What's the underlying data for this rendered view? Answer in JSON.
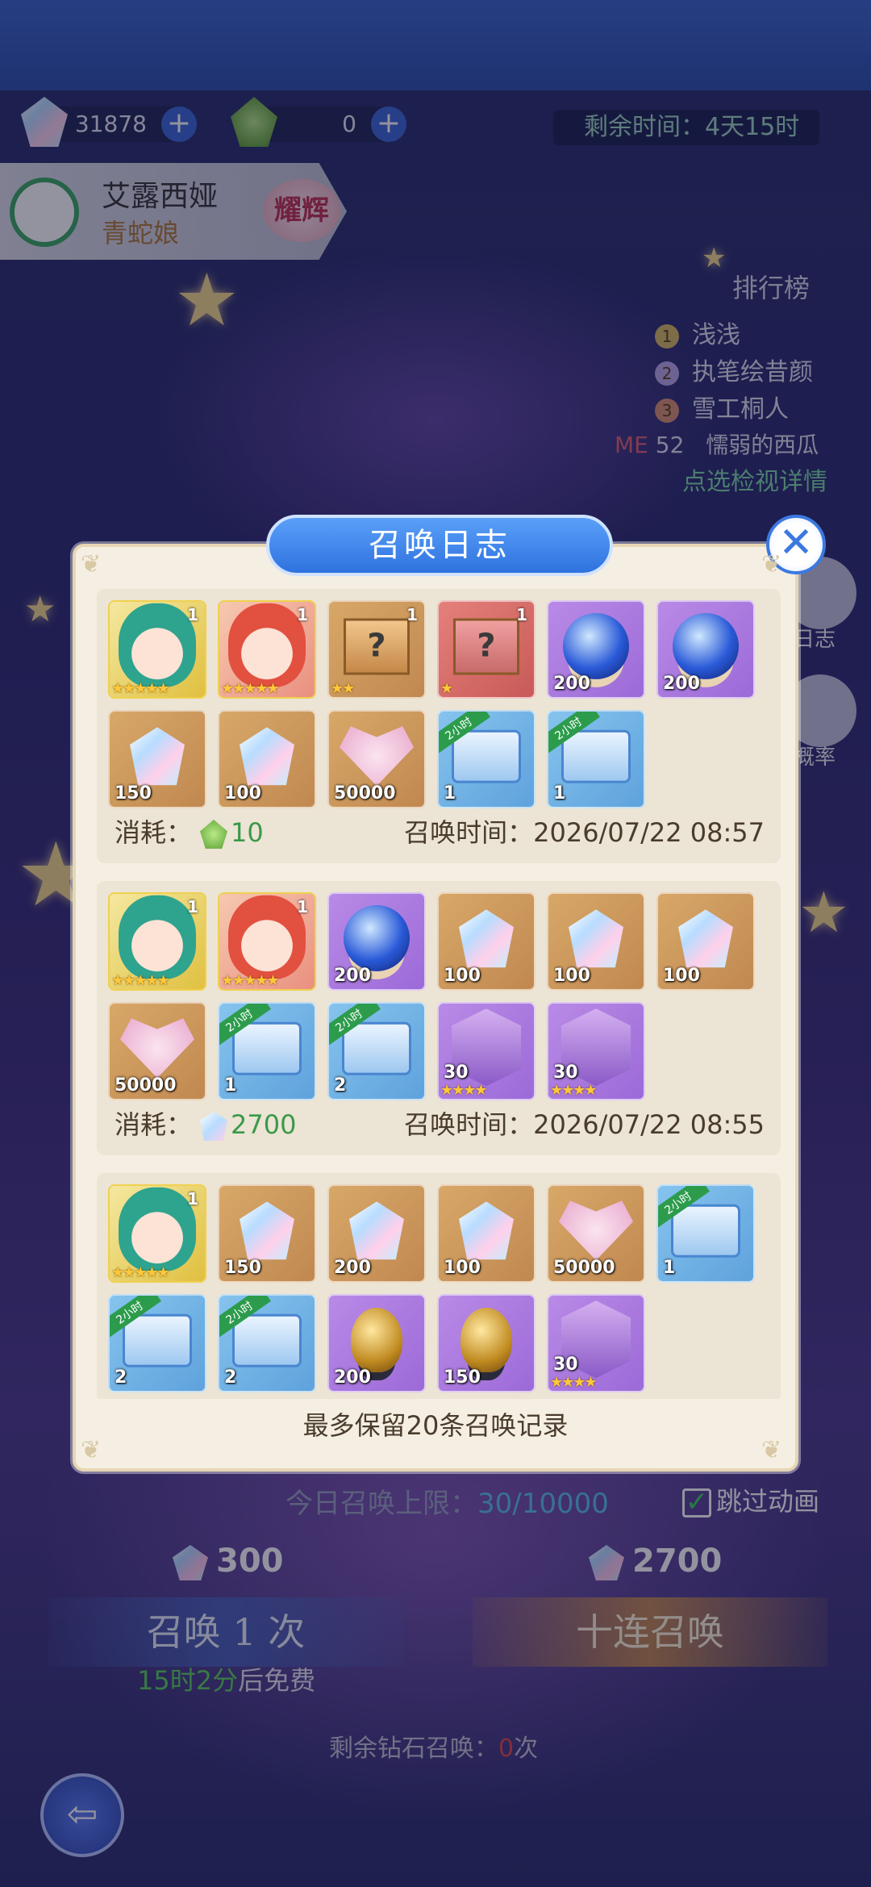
{
  "currency": {
    "diamonds": "31878",
    "hops": "0"
  },
  "timer": {
    "text": "剩余时间：4天15时"
  },
  "character": {
    "name": "艾露西娅",
    "title": "青蛇娘",
    "badge": "耀辉"
  },
  "ranking": {
    "title": "排行榜",
    "entries": [
      {
        "rank": "1",
        "name": "浅浅"
      },
      {
        "rank": "2",
        "name": "执笔绘昔颜"
      },
      {
        "rank": "3",
        "name": "雪工桐人"
      }
    ],
    "me": {
      "label": "ME",
      "rank": "52",
      "name": "懦弱的西瓜"
    },
    "link": "点选检视详情"
  },
  "side_buttons": {
    "log": "日志",
    "rate": "概率"
  },
  "modal": {
    "title": "召唤日志",
    "footer": "最多保留20条召唤记录",
    "cost_label": "消耗：",
    "time_label": "召唤时间：",
    "records": [
      {
        "cost": "10",
        "time": "2026/07/22 08:57",
        "items": [
          {
            "art": "face-green",
            "bg": "char-green",
            "level": "1",
            "stars": "★★★★★"
          },
          {
            "art": "face-red",
            "bg": "char-red",
            "level": "1",
            "stars": "★★★★★"
          },
          {
            "art": "box",
            "bg": "gold",
            "level": "1",
            "stars": "★★"
          },
          {
            "art": "box-red",
            "bg": "red",
            "level": "1",
            "stars": "★"
          },
          {
            "art": "orb",
            "bg": "purple",
            "qty": "200"
          },
          {
            "art": "orb",
            "bg": "purple",
            "qty": "200"
          },
          {
            "art": "crystal",
            "bg": "gold",
            "qty": "150"
          },
          {
            "art": "crystal",
            "bg": "gold",
            "qty": "100"
          },
          {
            "art": "heart",
            "bg": "gold",
            "qty": "50000"
          },
          {
            "art": "chest",
            "bg": "blue",
            "qty": "1",
            "tag": "2小时"
          },
          {
            "art": "chest",
            "bg": "blue",
            "qty": "1",
            "tag": "2小时"
          }
        ]
      },
      {
        "cost": "2700",
        "time": "2026/07/22 08:55",
        "items": [
          {
            "art": "face-green",
            "bg": "char-green",
            "level": "1",
            "stars": "★★★★★"
          },
          {
            "art": "face-red",
            "bg": "char-red",
            "level": "1",
            "stars": "★★★★★"
          },
          {
            "art": "orb",
            "bg": "purple",
            "qty": "200"
          },
          {
            "art": "crystal",
            "bg": "gold",
            "qty": "100"
          },
          {
            "art": "crystal",
            "bg": "gold",
            "qty": "100"
          },
          {
            "art": "crystal",
            "bg": "gold",
            "qty": "100"
          },
          {
            "art": "heart",
            "bg": "gold",
            "qty": "50000"
          },
          {
            "art": "chest",
            "bg": "blue",
            "qty": "1",
            "tag": "2小时"
          },
          {
            "art": "chest",
            "bg": "blue",
            "qty": "2",
            "tag": "2小时"
          },
          {
            "art": "shard",
            "bg": "purple",
            "qty": "30",
            "stars": "★★★★"
          },
          {
            "art": "shard",
            "bg": "purple",
            "qty": "30",
            "stars": "★★★★"
          }
        ]
      },
      {
        "cost": "",
        "time": "",
        "items": [
          {
            "art": "face-green",
            "bg": "char-green",
            "level": "1",
            "stars": "★★★★★"
          },
          {
            "art": "crystal",
            "bg": "gold",
            "qty": "150"
          },
          {
            "art": "crystal",
            "bg": "gold",
            "qty": "200"
          },
          {
            "art": "crystal",
            "bg": "gold",
            "qty": "100"
          },
          {
            "art": "heart",
            "bg": "gold",
            "qty": "50000"
          },
          {
            "art": "chest",
            "bg": "blue",
            "qty": "1",
            "tag": "2小时"
          },
          {
            "art": "chest",
            "bg": "blue",
            "qty": "2",
            "tag": "2小时"
          },
          {
            "art": "chest",
            "bg": "blue",
            "qty": "2",
            "tag": "2小时"
          },
          {
            "art": "egg",
            "bg": "purple",
            "qty": "200"
          },
          {
            "art": "egg",
            "bg": "purple",
            "qty": "150"
          },
          {
            "art": "shard",
            "bg": "purple",
            "qty": "30",
            "stars": "★★★★"
          }
        ]
      }
    ]
  },
  "summon": {
    "limit_label": "今日召唤上限：",
    "limit_value": "30/10000",
    "skip_label": "跳过动画",
    "single_cost": "300",
    "ten_cost": "2700",
    "single_label": "召唤 1 次",
    "ten_label": "十连召唤",
    "free_time": "15时2分",
    "free_suffix": "后免费",
    "remain_label": "剩余钻石召唤：",
    "remain_value": "0",
    "remain_suffix": "次"
  },
  "icons": {
    "close": "close-icon",
    "plus": "plus-icon",
    "back": "back-arrow-icon",
    "check": "check-icon"
  }
}
